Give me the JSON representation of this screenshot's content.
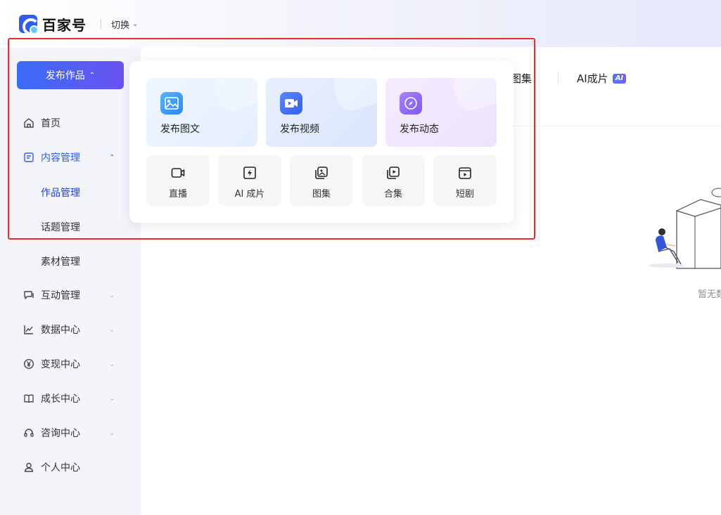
{
  "header": {
    "logo_text": "百家号",
    "switch_label": "切换"
  },
  "sidebar": {
    "publish_button": "发布作品",
    "items": [
      {
        "label": "首页",
        "icon": "home-icon"
      },
      {
        "label": "内容管理",
        "icon": "document-icon"
      },
      {
        "label": "互动管理",
        "icon": "chat-icon"
      },
      {
        "label": "数据中心",
        "icon": "chart-icon"
      },
      {
        "label": "变现中心",
        "icon": "yen-icon"
      },
      {
        "label": "成长中心",
        "icon": "book-icon"
      },
      {
        "label": "咨询中心",
        "icon": "headset-icon"
      },
      {
        "label": "个人中心",
        "icon": "user-icon"
      }
    ],
    "content_sub_items": [
      "作品管理",
      "话题管理",
      "素材管理"
    ]
  },
  "publish_menu": {
    "primary": [
      {
        "label": "发布图文",
        "icon": "image-icon"
      },
      {
        "label": "发布视频",
        "icon": "video-icon"
      },
      {
        "label": "发布动态",
        "icon": "compass-icon"
      }
    ],
    "secondary": [
      {
        "label": "直播",
        "icon": "live-camera-icon"
      },
      {
        "label": "AI 成片",
        "icon": "ai-flash-icon"
      },
      {
        "label": "图集",
        "icon": "gallery-icon"
      },
      {
        "label": "合集",
        "icon": "collection-icon"
      },
      {
        "label": "短剧",
        "icon": "short-drama-icon"
      }
    ]
  },
  "main": {
    "tabs": [
      {
        "label": "图集"
      },
      {
        "label": "AI成片",
        "badge": "AI"
      }
    ],
    "empty_text": "暂无数"
  },
  "colors": {
    "accent": "#2f5bf0",
    "highlight": "#ee2a2a",
    "button_gradient_start": "#3a6cf7",
    "button_gradient_end": "#6a52f2"
  }
}
